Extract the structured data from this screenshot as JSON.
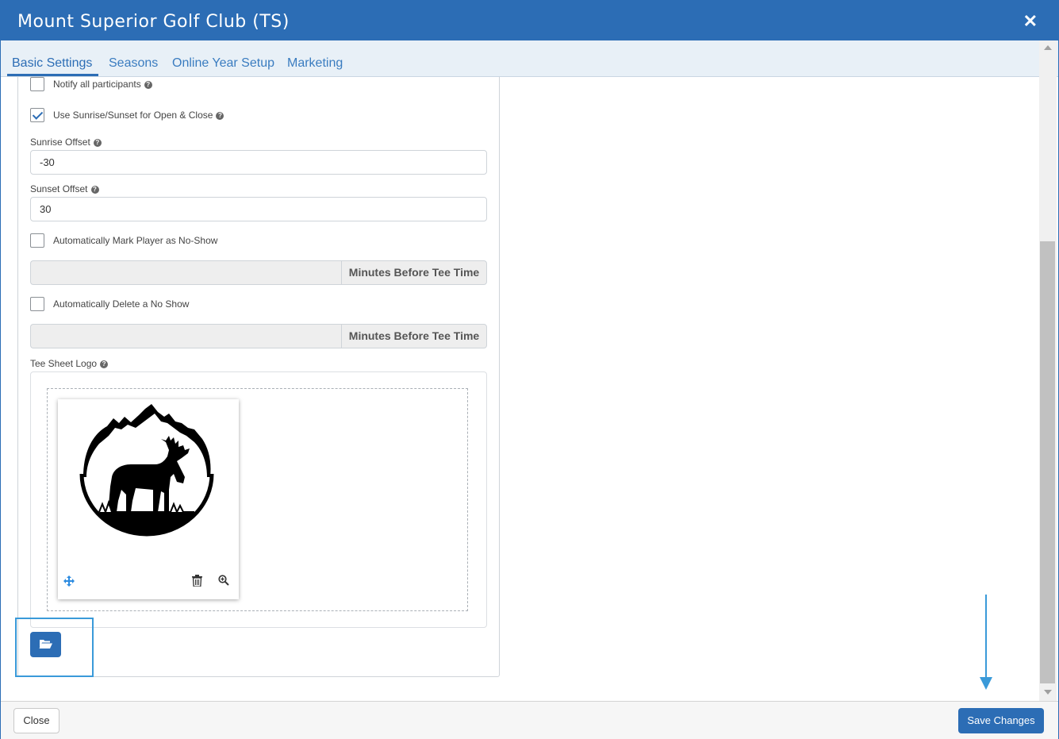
{
  "window": {
    "title": "Mount Superior Golf Club (TS)",
    "close_glyph": "✕"
  },
  "tabs": [
    {
      "label": "Basic Settings",
      "active": true
    },
    {
      "label": "Seasons"
    },
    {
      "label": "Online Year Setup"
    },
    {
      "label": "Marketing"
    }
  ],
  "form": {
    "notify_all": {
      "label": "Notify all participants",
      "checked": false
    },
    "use_sunrise": {
      "label": "Use Sunrise/Sunset for Open & Close",
      "checked": true
    },
    "sunrise_offset": {
      "label": "Sunrise Offset",
      "value": "-30"
    },
    "sunset_offset": {
      "label": "Sunset Offset",
      "value": "30"
    },
    "auto_no_show": {
      "label": "Automatically Mark Player as No-Show",
      "checked": false,
      "addon": "Minutes Before Tee Time",
      "value": ""
    },
    "auto_delete_no_show": {
      "label": "Automatically Delete a No Show",
      "checked": false,
      "addon": "Minutes Before Tee Time",
      "value": ""
    },
    "tee_sheet_logo": {
      "label": "Tee Sheet Logo"
    }
  },
  "help_glyph": "?",
  "footer": {
    "close_label": "Close",
    "save_label": "Save Changes"
  },
  "colors": {
    "primary": "#2c6db5",
    "annotation": "#3a9ad9"
  }
}
